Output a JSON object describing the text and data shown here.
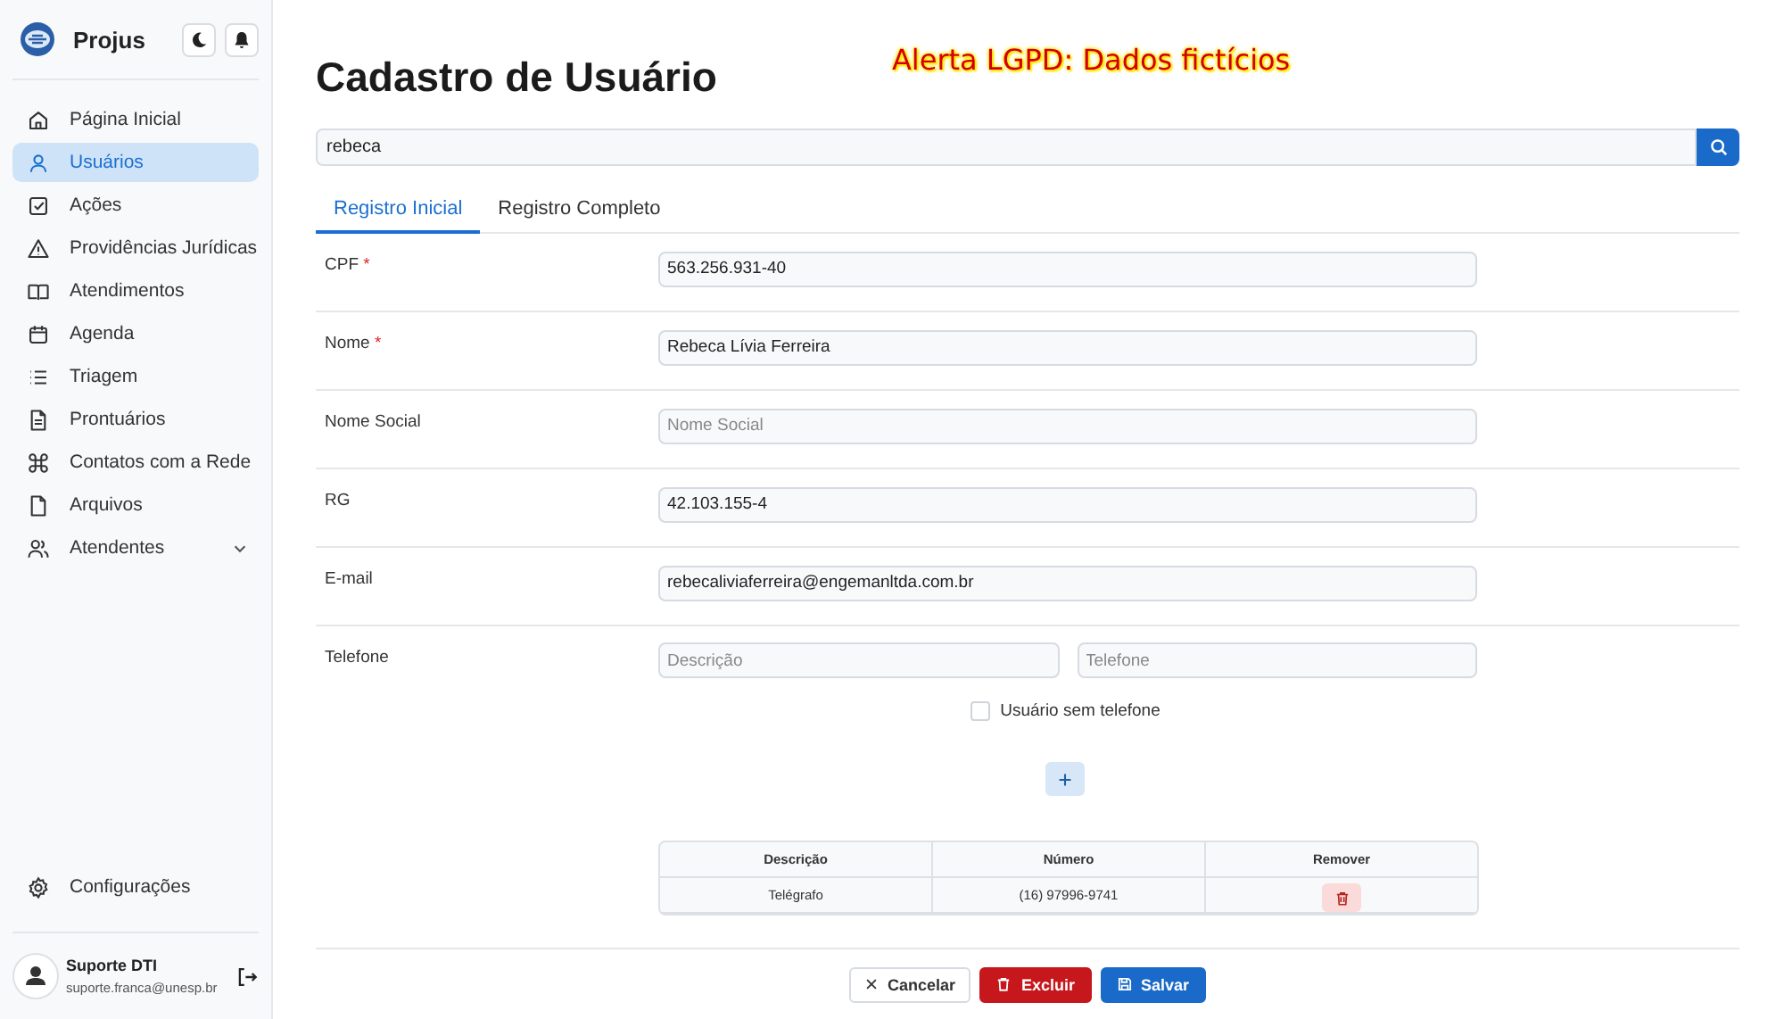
{
  "app": {
    "name": "Projus"
  },
  "sidebar": {
    "items": [
      {
        "label": "Página Inicial",
        "selected": false
      },
      {
        "label": "Usuários",
        "selected": true
      },
      {
        "label": "Ações",
        "selected": false
      },
      {
        "label": "Providências Jurídicas",
        "selected": false
      },
      {
        "label": "Atendimentos",
        "selected": false
      },
      {
        "label": "Agenda",
        "selected": false
      },
      {
        "label": "Triagem",
        "selected": false
      },
      {
        "label": "Prontuários",
        "selected": false
      },
      {
        "label": "Contatos com a Rede",
        "selected": false
      },
      {
        "label": "Arquivos",
        "selected": false
      },
      {
        "label": "Atendentes",
        "selected": false,
        "expanded": false
      }
    ],
    "settings": "Configurações",
    "user": {
      "name": "Suporte DTI",
      "email": "suporte.franca@unesp.br"
    }
  },
  "page": {
    "title": "Cadastro de Usuário",
    "alert": "Alerta LGPD: Dados fictícios"
  },
  "search": {
    "value": "rebeca"
  },
  "tabs": [
    {
      "label": "Registro Inicial",
      "selected": true
    },
    {
      "label": "Registro Completo",
      "selected": false
    }
  ],
  "fields": [
    {
      "kind": "text",
      "label": "CPF",
      "required_mark": "*",
      "value": "563.256.931-40"
    },
    {
      "kind": "text",
      "label": "Nome",
      "required_mark": "*",
      "value": "Rebeca Lívia Ferreira"
    },
    {
      "kind": "text",
      "label": "Nome Social",
      "placeholder": "Nome Social"
    },
    {
      "kind": "text",
      "label": "RG",
      "value": "42.103.155-4"
    },
    {
      "kind": "text",
      "label": "E-mail",
      "value": "rebecaliviaferreira@engemanltda.com.br"
    },
    {
      "kind": "phone",
      "label": "Telefone",
      "placeholders": [
        "Descrição",
        "Telefone"
      ]
    }
  ],
  "no_phone": {
    "label": "Usuário sem telefone",
    "checked": false
  },
  "phone_table": {
    "columns": [
      "Descrição",
      "Número",
      "Remover"
    ],
    "rows": [
      {
        "description": "Telégrafo",
        "number": "(16) 97996-9741"
      }
    ]
  },
  "footer": {
    "cancel": "Cancelar",
    "delete": "Excluir",
    "save": "Salvar"
  }
}
